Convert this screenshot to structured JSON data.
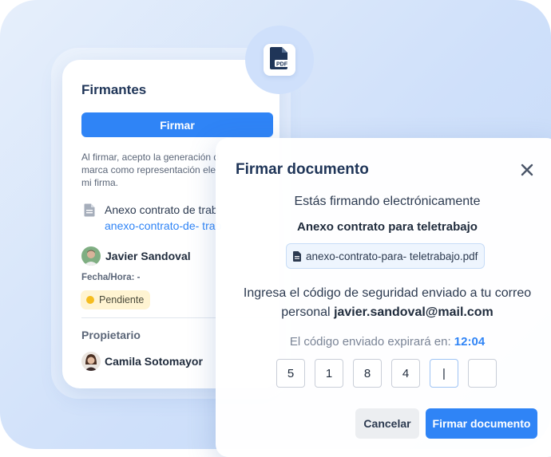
{
  "signers_card": {
    "title": "Firmantes",
    "sign_button": "Firmar",
    "consent_lines": [
      "Al firmar, acepto la generación d",
      "marca como representación ele",
      "mi firma."
    ],
    "document": {
      "icon": "document-icon",
      "name": "Anexo contrato de trab",
      "link": "anexo-contrato-de- trab"
    },
    "signer": {
      "name": "Javier Sandoval",
      "date_label": "Fecha/Hora: -",
      "status": "Pendiente",
      "status_color": "#f5bd1f"
    },
    "owner_label": "Propietario",
    "owner": {
      "name": "Camila Sotomayor"
    }
  },
  "pdf_badge": {
    "icon": "pdf-file-icon",
    "label": "PDF"
  },
  "modal": {
    "title": "Firmar documento",
    "close_icon": "close-icon",
    "line1": "Estás firmando electrónicamente",
    "doc_title": "Anexo contrato para teletrabajo",
    "file_name": "anexo-contrato-para- teletrabajo.pdf",
    "instruction_line1": "Ingresa el código de seguridad enviado a tu correo",
    "instruction_line2_prefix": "personal ",
    "email": "javier.sandoval@mail.com",
    "expire_label": "El código enviado expirará en: ",
    "expire_time": "12:04",
    "code_digits": [
      "5",
      "1",
      "8",
      "4",
      "|",
      ""
    ],
    "cancel_button": "Cancelar",
    "sign_button": "Firmar documento",
    "accent_color": "#2f84f6"
  }
}
